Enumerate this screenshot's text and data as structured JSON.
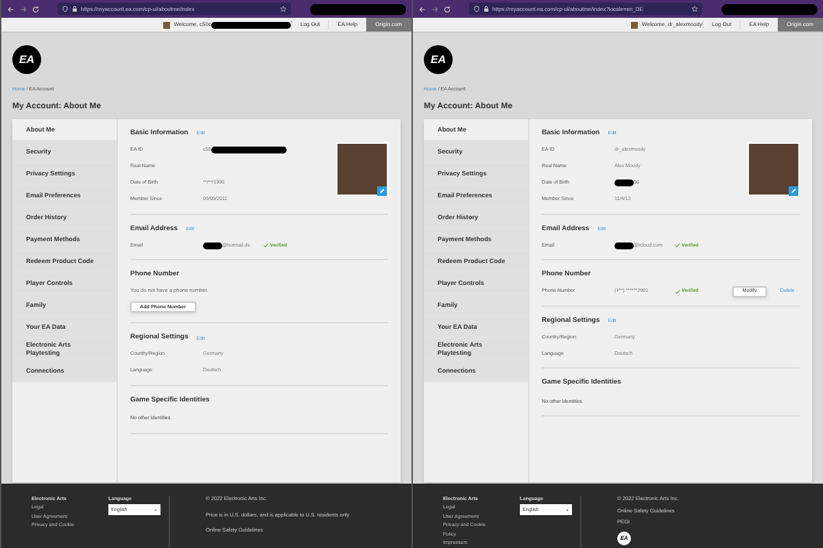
{
  "windows": [
    {
      "browser": {
        "url": "https://myaccount.ea.com/cp-ui/aboutme/index",
        "profile_redacted": true
      },
      "topbar": {
        "welcome": "Welcome, c50c",
        "welcome_redacted": true,
        "links": [
          "Log Out",
          "EA Help"
        ],
        "origin": "Origin.com"
      },
      "logo": "EA",
      "breadcrumb": {
        "home": "Home",
        "current": "/ EA Account"
      },
      "heading": "My Account: About Me",
      "sidebar": [
        {
          "label": "About Me",
          "selected": true
        },
        {
          "label": "Security",
          "selected": false
        },
        {
          "label": "Privacy Settings",
          "selected": false
        },
        {
          "label": "Email Preferences",
          "selected": false
        },
        {
          "label": "Order History",
          "selected": false
        },
        {
          "label": "Payment Methods",
          "selected": false
        },
        {
          "label": "Redeem Product Code",
          "selected": false
        },
        {
          "label": "Player Controls",
          "selected": false
        },
        {
          "label": "Family",
          "selected": false
        },
        {
          "label": "Your EA Data",
          "selected": false
        },
        {
          "label": "Electronic Arts Playtesting",
          "selected": false
        },
        {
          "label": "Connections",
          "selected": false
        }
      ],
      "sections": [
        {
          "kind": "basic",
          "title": "Basic Information",
          "edit": "Edit",
          "rows": [
            {
              "label": "EA ID",
              "value": "c50",
              "redacted_after": true
            },
            {
              "label": "Real Name"
            },
            {
              "label": "Date of Birth",
              "value": "**/**/1996"
            },
            {
              "label": "Member Since",
              "value": "09/09/2011"
            }
          ]
        },
        {
          "kind": "rows",
          "title": "Email Address",
          "edit": "Edit",
          "rows": [
            {
              "label": "Email",
              "value": "@hotmail.de",
              "redacted_before": true,
              "verified": "Verified"
            }
          ]
        },
        {
          "kind": "empty",
          "title": "Phone Number",
          "message": "You do not have a phone number.",
          "button": "Add Phone Number"
        },
        {
          "kind": "rows",
          "title": "Regional Settings",
          "edit": "Edit",
          "rows": [
            {
              "label": "Country/Region",
              "value": "Germany"
            },
            {
              "label": "Language",
              "value": "Deutsch"
            }
          ]
        },
        {
          "kind": "note",
          "title": "Game Specific Identities",
          "message": "No other Identities."
        }
      ],
      "footer": {
        "title": "Electronic Arts",
        "links": [
          "Legal",
          "User Agreement",
          "Privacy and Cookie"
        ],
        "language_label": "Language",
        "language": "English",
        "notes": [
          "© 2022 Electronic Arts Inc.",
          "Price is in U.S. dollars, and is applicable to U.S. residents only",
          "Online Safety Guidelines"
        ]
      }
    },
    {
      "browser": {
        "url": "https://myaccount.ea.com/cp-ui/aboutme/index?locale=en_DE",
        "profile_redacted": true
      },
      "topbar": {
        "welcome": "Welcome, dr_alexmoody",
        "links": [
          "Log Out",
          "EA Help"
        ],
        "origin": "Origin.com"
      },
      "logo": "EA",
      "breadcrumb": {
        "home": "Home",
        "current": "/ EA Account"
      },
      "heading": "My Account: About Me",
      "sidebar": [
        {
          "label": "About Me",
          "selected": true
        },
        {
          "label": "Security",
          "selected": false
        },
        {
          "label": "Privacy Settings",
          "selected": false
        },
        {
          "label": "Email Preferences",
          "selected": false
        },
        {
          "label": "Order History",
          "selected": false
        },
        {
          "label": "Payment Methods",
          "selected": false
        },
        {
          "label": "Redeem Product Code",
          "selected": false
        },
        {
          "label": "Player Controls",
          "selected": false
        },
        {
          "label": "Family",
          "selected": false
        },
        {
          "label": "Your EA Data",
          "selected": false
        },
        {
          "label": "Electronic Arts Playtesting",
          "selected": false
        },
        {
          "label": "Connections",
          "selected": false
        }
      ],
      "sections": [
        {
          "kind": "basic",
          "title": "Basic Information",
          "edit": "Edit",
          "rows": [
            {
              "label": "EA ID",
              "value": "dr_alexmoody"
            },
            {
              "label": "Real Name",
              "value": "Alex Moody"
            },
            {
              "label": "Date of Birth",
              "value": "96",
              "redacted_before": true
            },
            {
              "label": "Member Since",
              "value": "11/4/13"
            }
          ]
        },
        {
          "kind": "rows",
          "title": "Email Address",
          "edit": "Edit",
          "rows": [
            {
              "label": "Email",
              "value": "@icloud.com",
              "redacted_before": true,
              "verified": "Verified"
            }
          ]
        },
        {
          "kind": "rows",
          "title": "Phone Number",
          "rows": [
            {
              "label": "Phone Number",
              "value": "(+**) ******2901",
              "verified": "Verified",
              "button": "Modify",
              "link": "Delete"
            }
          ]
        },
        {
          "kind": "rows",
          "title": "Regional Settings",
          "edit": "Edit",
          "rows": [
            {
              "label": "Country/Region",
              "value": "Germany"
            },
            {
              "label": "Language",
              "value": "Deutsch"
            }
          ]
        },
        {
          "kind": "note",
          "title": "Game Specific Identities",
          "message": "No other Identities."
        }
      ],
      "footer": {
        "title": "Electronic Arts",
        "links": [
          "Legal",
          "User Agreement",
          "Privacy and Cookie",
          "Policy",
          "Impressum"
        ],
        "language_label": "Language",
        "language": "English",
        "notes": [
          "© 2022 Electronic Arts Inc.",
          "Online Safety Guidelines",
          "PEGI"
        ],
        "logo": "EA"
      }
    }
  ]
}
